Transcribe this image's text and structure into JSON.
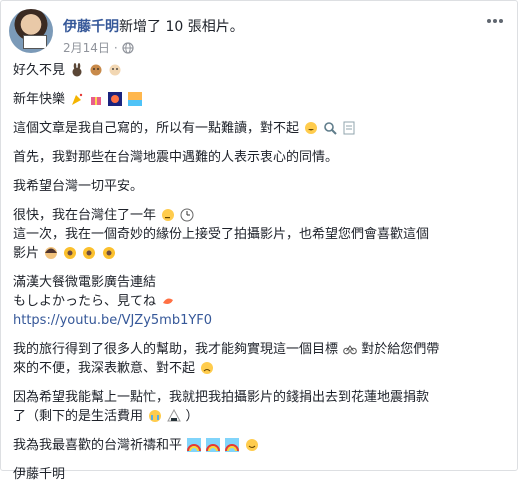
{
  "post": {
    "author": "伊藤千明",
    "action": "新增了 10 張相片。",
    "date": "2月14日",
    "avatar_sign_text": "",
    "paragraphs": [
      {
        "lines": [
          "好久不見"
        ],
        "emojis": [
          "rabbit",
          "dog",
          "hamster"
        ]
      },
      {
        "lines": [
          "新年快樂"
        ],
        "emojis": [
          "party-popper",
          "gift",
          "fireworks",
          "beach"
        ]
      },
      {
        "lines": [
          "這個文章是我自己寫的，所以有一點難讀，對不起"
        ],
        "emojis": [
          "grinning",
          "magnifier",
          "memo"
        ]
      },
      {
        "lines": [
          "首先，我對那些在台灣地震中遇難的人表示衷心的同情。"
        ]
      },
      {
        "lines": [
          "我希望台灣一切平安。"
        ]
      },
      {
        "lines": [
          "很快，我在台灣住了一年",
          "這一次，我在一個奇妙的緣份上接受了拍攝影片，也希望您們會喜歡這個",
          "影片"
        ]
      },
      {
        "lines": [
          "滿漢大餐微電影廣告連結",
          "もしよかったら、見てね",
          "https://youtu.be/VJZy5mb1YF0"
        ]
      },
      {
        "lines": [
          "我的旅行得到了很多人的幫助，我才能夠實現這一個目標",
          "對於給您們帶",
          "來的不便，我深表歉意、對不起"
        ]
      },
      {
        "lines": [
          "因為希望我能幫上一點忙，我就把我拍攝影片的錢捐出去到花蓮地震捐款",
          "了（剩下的是生活費用",
          "）"
        ]
      },
      {
        "lines": [
          "我為我最喜歡的台灣祈禱和平"
        ]
      },
      {
        "lines": [
          "伊藤千明"
        ]
      }
    ]
  },
  "icons": {
    "globe": "globe-icon",
    "more": "more-options-icon"
  },
  "colors": {
    "link": "#365899",
    "text": "#1d2129",
    "meta": "#90949c"
  }
}
